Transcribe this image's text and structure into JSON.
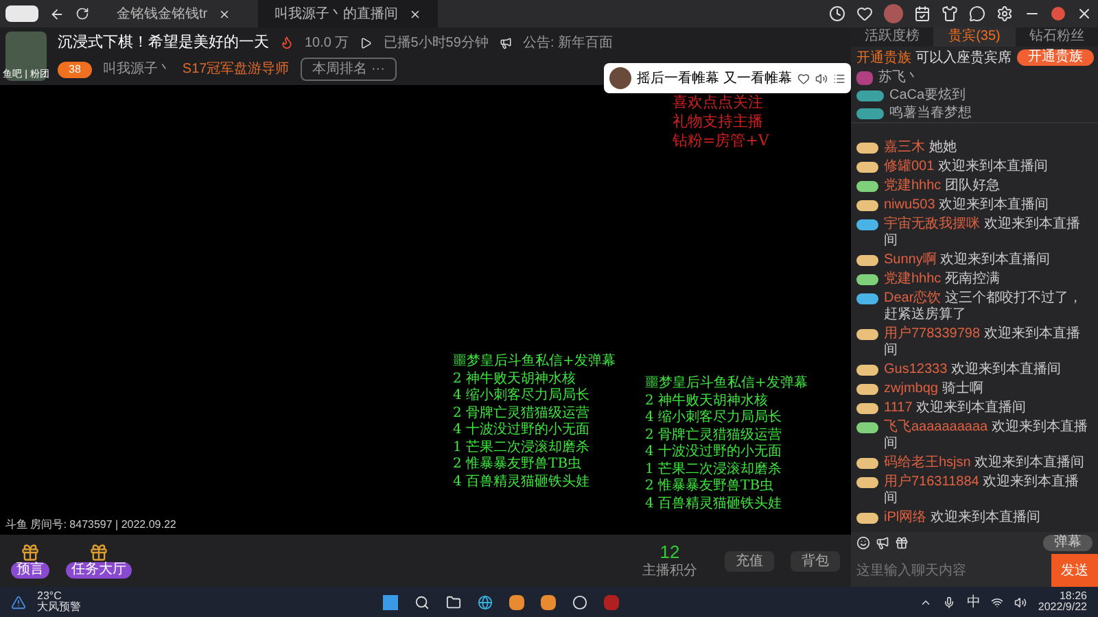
{
  "browser_tabs": [
    {
      "label": "金铭钱金铭钱tr",
      "selected": false
    },
    {
      "label": "叫我源子丶的直播间",
      "selected": true
    }
  ],
  "header": {
    "avatar_caption": "鱼吧 | 粉团",
    "title": "沉浸式下棋！希望是美好的一天",
    "hot": "10.0 万",
    "duration": "已播5小时59分钟",
    "notice": "公告: 新年百面",
    "level": "38",
    "streamer": "叫我源子丶",
    "honor": "S17冠军盘游导师",
    "rank_button": "本周排名 ···"
  },
  "player_popup": {
    "song": "摇后一看帷幕 又一看帷幕"
  },
  "overlay_red": [
    "喜欢点点关注",
    "礼物支持主播",
    "钻粉=房管+V"
  ],
  "overlay_green": [
    "噩梦皇后斗鱼私信+发弹幕",
    "2 神牛败天胡神水核",
    "4 缩小刺客尽力局局长",
    "2 骨牌亡灵猎猫级运营",
    "4 十波没过野的小无面",
    "1 芒果二次浸滚却磨杀",
    "2 惟暴暴友野兽TB虫",
    "4 百兽精灵猫砸铁头娃"
  ],
  "overlay_green_2": [
    "噩梦皇后斗鱼私信+发弹幕",
    "2 神牛败天胡神水核",
    "4 缩小刺客尽力局局长",
    "2 骨牌亡灵猎猫级运营",
    "4 十波没过野的小无面",
    "1 芒果二次浸滚却磨杀",
    "2 惟暴暴友野兽TB虫",
    "4 百兽精灵猫砸铁头娃"
  ],
  "room_info": "斗鱼 房间号: 8473597 | 2022.09.22",
  "gifts": [
    {
      "label": "预言"
    },
    {
      "label": "任务大厅"
    }
  ],
  "score": {
    "value": "12",
    "label": "主播积分"
  },
  "wallet": [
    "充值",
    "背包"
  ],
  "chat": {
    "tabs": [
      {
        "label": "活跃度榜",
        "selected": false
      },
      {
        "label": "贵宾(35)",
        "selected": true
      },
      {
        "label": "钻石粉丝",
        "selected": false
      }
    ],
    "notice": {
      "highlight": "开通贵族",
      "text": "可以入座贵宾席",
      "button": "开通贵族"
    },
    "vips": [
      {
        "name": "苏飞丶",
        "kind": "noble"
      },
      {
        "name": "CaCa要炫到",
        "kind": "fan"
      },
      {
        "name": "鸣薯当春梦想",
        "kind": "fan"
      }
    ],
    "messages": [
      {
        "user": "嘉三木",
        "text": "她她",
        "color": "#e8c07a"
      },
      {
        "user": "修罐001",
        "text": "欢迎来到本直播间",
        "color": "#e8c07a"
      },
      {
        "user": "党建hhhc",
        "text": "团队好急",
        "color": "#7fd07a"
      },
      {
        "user": "niwu503",
        "text": "欢迎来到本直播间",
        "color": "#e8c07a"
      },
      {
        "user": "宇宙无敌我摆咪",
        "text": "欢迎来到本直播间",
        "color": "#4ab3e6"
      },
      {
        "user": "Sunny啊",
        "text": "欢迎来到本直播间",
        "color": "#e8c07a"
      },
      {
        "user": "党建hhhc",
        "text": "死南控满",
        "color": "#7fd07a"
      },
      {
        "user": "Dear恋饮",
        "text": "这三个都咬打不过了，赶紧送房算了",
        "color": "#4ab3e6"
      },
      {
        "user": "用户778339798",
        "text": "欢迎来到本直播间",
        "color": "#e8c07a"
      },
      {
        "user": "Gus12333",
        "text": "欢迎来到本直播间",
        "color": "#e8c07a"
      },
      {
        "user": "zwjmbqg",
        "text": "骑士啊",
        "color": "#e8c07a"
      },
      {
        "user": "1117",
        "text": "欢迎来到本直播间",
        "color": "#e8c07a"
      },
      {
        "user": "飞飞aaaaaaaaaa",
        "text": "欢迎来到本直播间",
        "color": "#7fd07a"
      },
      {
        "user": "码给老王hsjsn",
        "text": "欢迎来到本直播间",
        "color": "#e8c07a"
      },
      {
        "user": "用户716311884",
        "text": "欢迎来到本直播间",
        "color": "#e8c07a"
      },
      {
        "user": "iPl网络",
        "text": "欢迎来到本直播间",
        "color": "#e8c07a"
      }
    ],
    "barrage_toggle": {
      "label": "弹幕",
      "on": false
    },
    "input": {
      "placeholder": "这里输入聊天内容"
    },
    "send": "发送"
  },
  "taskbar": {
    "temp": "23°C",
    "weather": "大风预警",
    "ime": "中",
    "time": "18:26",
    "date": "2022/9/22"
  }
}
